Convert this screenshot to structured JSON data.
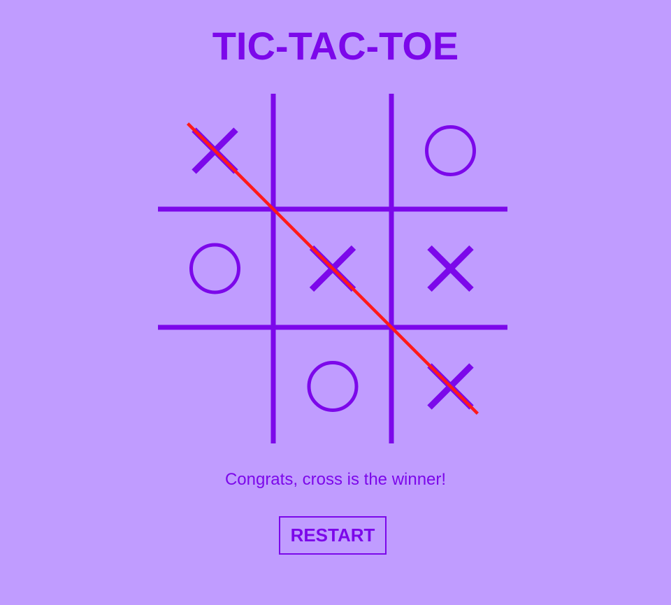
{
  "title": "TIC-TAC-TOE",
  "board": {
    "cells": [
      "X",
      "",
      "O",
      "O",
      "X",
      "X",
      "",
      "O",
      "X"
    ],
    "winning_line": [
      0,
      4,
      8
    ]
  },
  "status": {
    "message": "Congrats, cross is the winner!"
  },
  "controls": {
    "restart_label": "RESTART"
  },
  "colors": {
    "background": "#c09cff",
    "accent": "#7c08ea",
    "win_line": "#ff1a1a"
  },
  "icons": {
    "cross": "cross-mark-icon",
    "nought": "nought-mark-icon"
  }
}
